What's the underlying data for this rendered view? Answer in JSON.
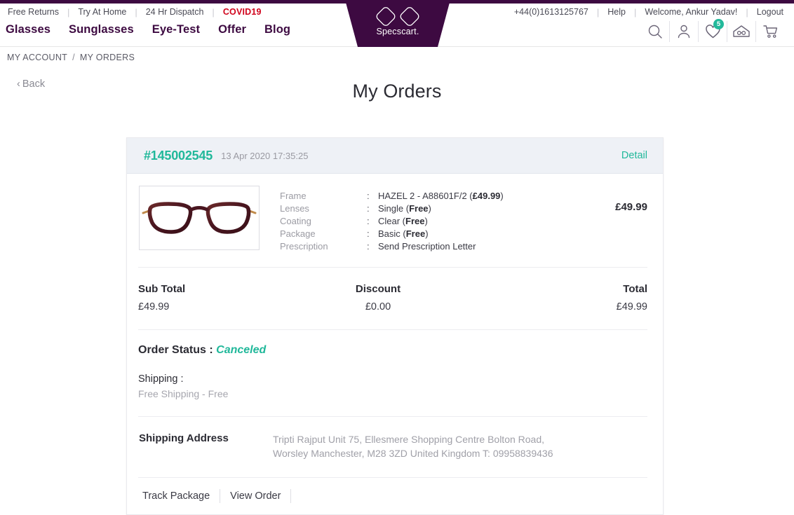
{
  "theme": {
    "purple": "#3d0a41",
    "teal": "#20b89a",
    "red": "#d0021b",
    "card_header_bg": "#eef1f6"
  },
  "header": {
    "utility_left": [
      {
        "label": "Free Returns",
        "name": "free-returns"
      },
      {
        "label": "Try At Home",
        "name": "try-at-home"
      },
      {
        "label": "24 Hr Dispatch",
        "name": "24-hr-dispatch"
      },
      {
        "label": "COVID19",
        "name": "covid19"
      }
    ],
    "utility_right": [
      {
        "label": "+44(0)1613125767",
        "name": "phone-number"
      },
      {
        "label": "Help",
        "name": "help"
      },
      {
        "label": "Welcome, Ankur Yadav!",
        "name": "welcome-user"
      },
      {
        "label": "Logout",
        "name": "logout"
      }
    ],
    "nav": [
      {
        "label": "Glasses",
        "name": "glasses"
      },
      {
        "label": "Sunglasses",
        "name": "sunglasses"
      },
      {
        "label": "Eye-Test",
        "name": "eye-test"
      },
      {
        "label": "Offer",
        "name": "offer"
      },
      {
        "label": "Blog",
        "name": "blog"
      }
    ],
    "logo_text": "Specscart.",
    "icons": [
      {
        "name": "search-icon"
      },
      {
        "name": "user-account-icon"
      },
      {
        "name": "wishlist-heart-icon",
        "badge": "5"
      },
      {
        "name": "home-tryon-icon"
      },
      {
        "name": "shopping-cart-icon"
      }
    ]
  },
  "breadcrumb": {
    "items": [
      "MY ACCOUNT",
      "MY ORDERS"
    ],
    "separator": "/"
  },
  "back_link": {
    "chevron": "‹",
    "label": "Back"
  },
  "page_title": "My Orders",
  "order": {
    "number": "#145002545",
    "date": "13 Apr 2020 17:35:25",
    "detail_label": "Detail",
    "product": {
      "image_name": "eyeglasses-thumbnail",
      "price": "£49.99",
      "specs": [
        {
          "label": "Frame",
          "colon": ":",
          "value": "HAZEL 2 - A88601F/2 (",
          "bold": "£49.99",
          "suffix": ")"
        },
        {
          "label": "Lenses",
          "colon": ":",
          "value": "Single (",
          "bold": "Free",
          "suffix": ")"
        },
        {
          "label": "Coating",
          "colon": ":",
          "value": "Clear (",
          "bold": "Free",
          "suffix": ")"
        },
        {
          "label": "Package",
          "colon": ":",
          "value": "Basic (",
          "bold": "Free",
          "suffix": ")"
        },
        {
          "label": "Prescription",
          "colon": ":",
          "value": "Send Prescription Letter",
          "bold": "",
          "suffix": ""
        }
      ]
    },
    "totals": [
      {
        "label": "Sub Total",
        "value": "£49.99",
        "name": "sub-total"
      },
      {
        "label": "Discount",
        "value": "£0.00",
        "name": "discount"
      },
      {
        "label": "Total",
        "value": "£49.99",
        "name": "grand-total"
      }
    ],
    "status": {
      "label": "Order Status :",
      "value": "Canceled"
    },
    "shipping": {
      "label": "Shipping :",
      "value": "Free Shipping - Free"
    },
    "address": {
      "label": "Shipping Address",
      "line1": "Tripti Rajput Unit 75, Ellesmere Shopping Centre Bolton Road,",
      "line2": "Worsley Manchester, M28 3ZD United Kingdom T: 09958839436"
    },
    "actions": [
      {
        "label": "Track Package",
        "name": "track-package"
      },
      {
        "label": "View Order",
        "name": "view-order"
      }
    ]
  }
}
